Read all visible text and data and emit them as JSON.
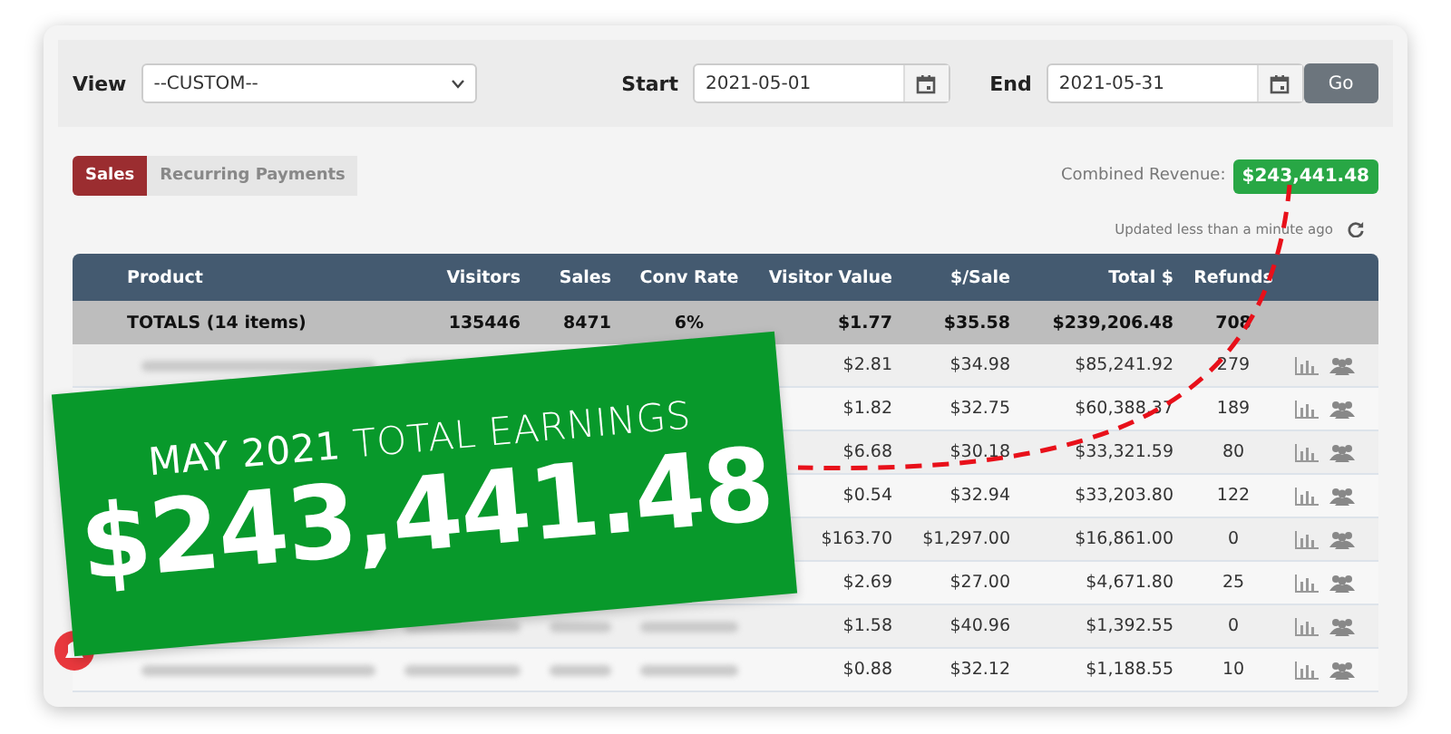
{
  "filters": {
    "view_label": "View",
    "view_value": "--CUSTOM--",
    "start_label": "Start",
    "start_value": "2021-05-01",
    "end_label": "End",
    "end_value": "2021-05-31",
    "go_button": "Go"
  },
  "tabs": [
    {
      "label": "Sales",
      "selected": true
    },
    {
      "label": "Recurring Payments",
      "selected": false
    }
  ],
  "combined_revenue": {
    "label": "Combined Revenue:",
    "value": "$243,441.48"
  },
  "updated": "Updated less than a minute ago",
  "table": {
    "columns": [
      "Product",
      "Visitors",
      "Sales",
      "Conv Rate",
      "Visitor Value",
      "$/Sale",
      "Total $",
      "Refunds"
    ],
    "totals": [
      "TOTALS (14 items)",
      "135446",
      "8471",
      "6%",
      "$1.77",
      "$35.58",
      "$239,206.48",
      "708"
    ],
    "rows": [
      {
        "visitor_value": "$2.81",
        "per_sale": "$34.98",
        "total": "$85,241.92",
        "refunds": "279"
      },
      {
        "visitor_value": "$1.82",
        "per_sale": "$32.75",
        "total": "$60,388.37",
        "refunds": "189"
      },
      {
        "visitor_value": "$6.68",
        "per_sale": "$30.18",
        "total": "$33,321.59",
        "refunds": "80"
      },
      {
        "visitor_value": "$0.54",
        "per_sale": "$32.94",
        "total": "$33,203.80",
        "refunds": "122"
      },
      {
        "visitor_value": "$163.70",
        "per_sale": "$1,297.00",
        "total": "$16,861.00",
        "refunds": "0"
      },
      {
        "visitor_value": "$2.69",
        "per_sale": "$27.00",
        "total": "$4,671.80",
        "refunds": "25"
      },
      {
        "visitor_value": "$1.58",
        "per_sale": "$40.96",
        "total": "$1,392.55",
        "refunds": "0"
      },
      {
        "visitor_value": "$0.88",
        "per_sale": "$32.12",
        "total": "$1,188.55",
        "refunds": "10"
      }
    ]
  },
  "banner": {
    "headline": "**MAY 2021** TOTAL EARNINGS",
    "amount": "$243,441.48"
  }
}
